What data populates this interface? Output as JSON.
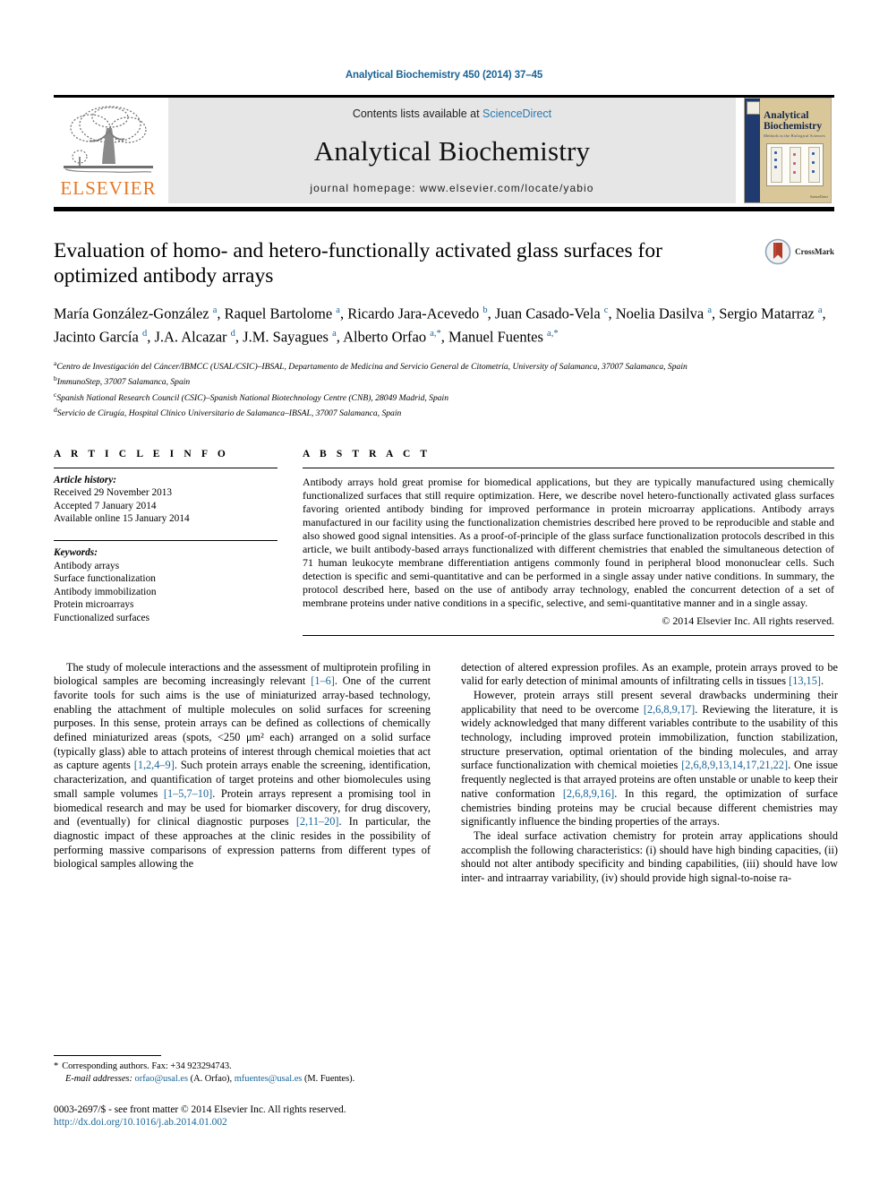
{
  "running_head": "Analytical Biochemistry 450 (2014) 37–45",
  "masthead": {
    "contents_prefix": "Contents lists available at ",
    "sciencedirect": "ScienceDirect",
    "journal_title": "Analytical Biochemistry",
    "homepage": "journal homepage: www.elsevier.com/locate/yabio",
    "publisher_wordmark": "ELSEVIER",
    "cover": {
      "title_line1": "Analytical",
      "title_line2": "Biochemistry",
      "subtitle": "Methods in the Biological Sciences",
      "footer": "ScienceDirect"
    },
    "brand_orange": "#e87722",
    "link_blue": "#2a7ab0"
  },
  "article": {
    "title": "Evaluation of homo- and hetero-functionally activated glass surfaces for optimized antibody arrays",
    "crossmark_label": "CrossMark",
    "authors_html": "María González-González <sup>a</sup>, Raquel Bartolome <sup>a</sup>, Ricardo Jara-Acevedo <sup>b</sup>, Juan Casado-Vela <sup>c</sup>, Noelia Dasilva <sup>a</sup>, Sergio Matarraz <sup>a</sup>, Jacinto García <sup>d</sup>, J.A. Alcazar <sup>d</sup>, J.M. Sayagues <sup>a</sup>, Alberto Orfao <sup>a,*</sup>, Manuel Fuentes <sup>a,*</sup>",
    "affiliations": [
      {
        "mark": "a",
        "text": "Centro de Investigación del Cáncer/IBMCC (USAL/CSIC)–IBSAL, Departamento de Medicina and Servicio General de Citometría, University of Salamanca, 37007 Salamanca, Spain"
      },
      {
        "mark": "b",
        "text": "ImmunoStep, 37007 Salamanca, Spain"
      },
      {
        "mark": "c",
        "text": "Spanish National Research Council (CSIC)–Spanish National Biotechnology Centre (CNB), 28049 Madrid, Spain"
      },
      {
        "mark": "d",
        "text": "Servicio de Cirugía, Hospital Clínico Universitario de Salamanca–IBSAL, 37007 Salamanca, Spain"
      }
    ]
  },
  "article_info": {
    "heading": "A R T I C L E    I N F O",
    "history_label": "Article history:",
    "history": [
      "Received 29 November 2013",
      "Accepted 7 January 2014",
      "Available online 15 January 2014"
    ],
    "keywords_label": "Keywords:",
    "keywords": [
      "Antibody arrays",
      "Surface functionalization",
      "Antibody immobilization",
      "Protein microarrays",
      "Functionalized surfaces"
    ]
  },
  "abstract": {
    "heading": "A B S T R A C T",
    "text": "Antibody arrays hold great promise for biomedical applications, but they are typically manufactured using chemically functionalized surfaces that still require optimization. Here, we describe novel hetero-functionally activated glass surfaces favoring oriented antibody binding for improved performance in protein microarray applications. Antibody arrays manufactured in our facility using the functionalization chemistries described here proved to be reproducible and stable and also showed good signal intensities. As a proof-of-principle of the glass surface functionalization protocols described in this article, we built antibody-based arrays functionalized with different chemistries that enabled the simultaneous detection of 71 human leukocyte membrane differentiation antigens commonly found in peripheral blood mononuclear cells. Such detection is specific and semi-quantitative and can be performed in a single assay under native conditions. In summary, the protocol described here, based on the use of antibody array technology, enabled the concurrent detection of a set of membrane proteins under native conditions in a specific, selective, and semi-quantitative manner and in a single assay.",
    "copyright": "© 2014 Elsevier Inc. All rights reserved."
  },
  "body": {
    "left_paragraphs": [
      "The study of molecule interactions and the assessment of multiprotein profiling in biological samples are becoming increasingly relevant [1–6]. One of the current favorite tools for such aims is the use of miniaturized array-based technology, enabling the attachment of multiple molecules on solid surfaces for screening purposes. In this sense, protein arrays can be defined as collections of chemically defined miniaturized areas (spots, <250 μm² each) arranged on a solid surface (typically glass) able to attach proteins of interest through chemical moieties that act as capture agents [1,2,4–9]. Such protein arrays enable the screening, identification, characterization, and quantification of target proteins and other biomolecules using small sample volumes [1–5,7–10]. Protein arrays represent a promising tool in biomedical research and may be used for biomarker discovery, for drug discovery, and (eventually) for clinical diagnostic purposes [2,11–20]. In particular, the diagnostic impact of these approaches at the clinic resides in the possibility of performing massive comparisons of expression patterns from different types of biological samples allowing the"
    ],
    "right_paragraphs": [
      "detection of altered expression profiles. As an example, protein arrays proved to be valid for early detection of minimal amounts of infiltrating cells in tissues [13,15].",
      "However, protein arrays still present several drawbacks undermining their applicability that need to be overcome [2,6,8,9,17]. Reviewing the literature, it is widely acknowledged that many different variables contribute to the usability of this technology, including improved protein immobilization, function stabilization, structure preservation, optimal orientation of the binding molecules, and array surface functionalization with chemical moieties [2,6,8,9,13,14,17,21,22]. One issue frequently neglected is that arrayed proteins are often unstable or unable to keep their native conformation [2,6,8,9,16]. In this regard, the optimization of surface chemistries binding proteins may be crucial because different chemistries may significantly influence the binding properties of the arrays.",
      "The ideal surface activation chemistry for protein array applications should accomplish the following characteristics: (i) should have high binding capacities, (ii) should not alter antibody specificity and binding capabilities, (iii) should have low inter- and intraarray variability, (iv) should provide high signal-to-noise ra-"
    ]
  },
  "footnote": {
    "star": "*",
    "corresponding": "Corresponding authors. Fax: +34 923294743.",
    "email_label": "E-mail addresses:",
    "email1": "orfao@usal.es",
    "email1_owner": "(A. Orfao),",
    "email2": "mfuentes@usal.es",
    "email2_owner": "(M. Fuentes)."
  },
  "footer": {
    "issn_line": "0003-2697/$ - see front matter © 2014 Elsevier Inc. All rights reserved.",
    "doi": "http://dx.doi.org/10.1016/j.ab.2014.01.002"
  }
}
